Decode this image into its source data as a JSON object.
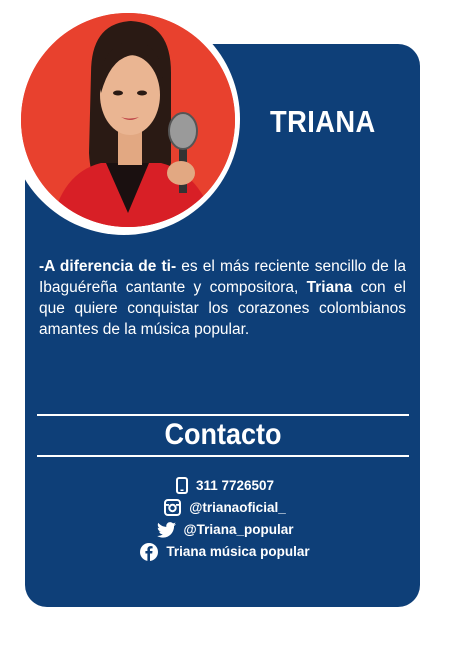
{
  "profile": {
    "name": "TRIANA"
  },
  "description": {
    "lead": "-A diferencia de ti-",
    "part1": " es el más reciente sencillo de la Ibaguéreña cantante y compositora, ",
    "bold_name": "Triana",
    "part2": " con el que quiere conquistar los corazones colombianos amantes de la música popular."
  },
  "contact": {
    "title": "Contacto",
    "items": [
      {
        "icon": "phone-icon",
        "text": "311 7726507"
      },
      {
        "icon": "instagram-icon",
        "text": "@trianaoficial_"
      },
      {
        "icon": "twitter-icon",
        "text": "@Triana_popular"
      },
      {
        "icon": "facebook-icon",
        "text": "Triana música popular"
      }
    ]
  },
  "colors": {
    "card_background": "#0e3f78",
    "photo_background": "#e8412e",
    "text": "#ffffff"
  }
}
